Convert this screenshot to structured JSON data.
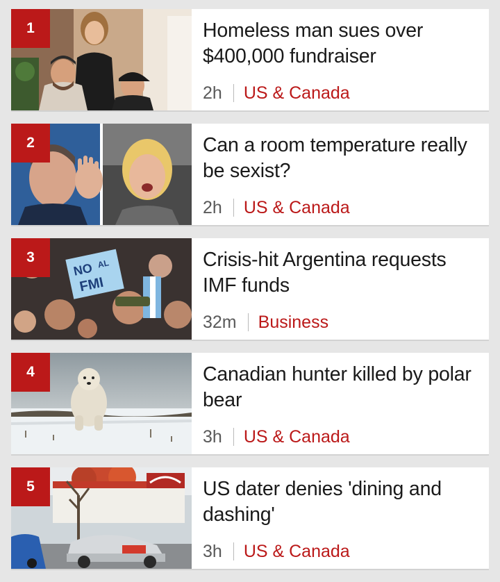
{
  "stories": [
    {
      "rank": "1",
      "headline": "Homeless man sues over $400,000 fundraiser",
      "time": "2h",
      "section": "US & Canada"
    },
    {
      "rank": "2",
      "headline": "Can a room temperature really be sexist?",
      "time": "2h",
      "section": "US & Canada"
    },
    {
      "rank": "3",
      "headline": "Crisis-hit Argentina requests IMF funds",
      "time": "32m",
      "section": "Business",
      "sign_text": [
        "NO",
        "AL",
        "FMI"
      ]
    },
    {
      "rank": "4",
      "headline": "Canadian hunter killed by polar bear",
      "time": "3h",
      "section": "US & Canada"
    },
    {
      "rank": "5",
      "headline": "US dater denies 'dining and dashing'",
      "time": "3h",
      "section": "US & Canada"
    }
  ],
  "colors": {
    "accent": "#bb1919",
    "background": "#e6e6e6",
    "card": "#ffffff",
    "time_text": "#5a5a5a"
  }
}
